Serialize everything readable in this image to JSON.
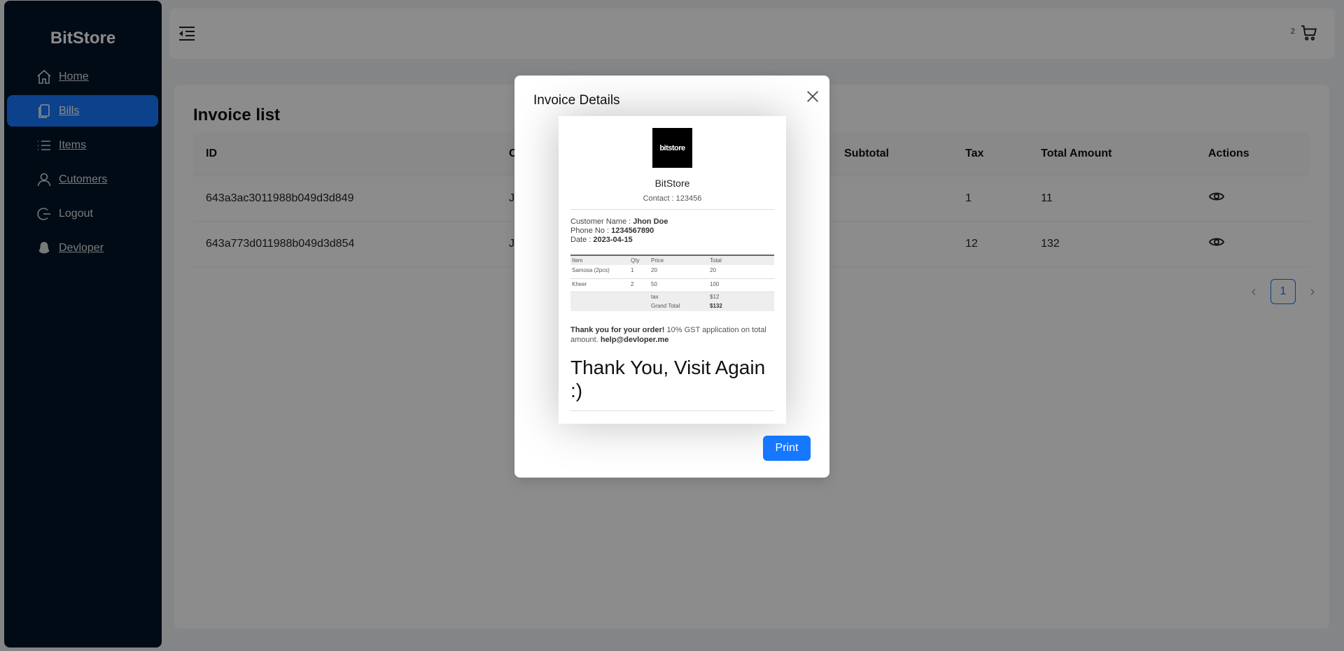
{
  "brand": "BitStore",
  "sidebar": {
    "items": [
      {
        "label": "Home",
        "icon": "home-icon"
      },
      {
        "label": "Bills",
        "icon": "bills-icon",
        "active": true
      },
      {
        "label": "Items",
        "icon": "list-icon"
      },
      {
        "label": "Cutomers",
        "icon": "user-icon"
      },
      {
        "label": "Logout",
        "icon": "logout-icon"
      },
      {
        "label": "Devloper",
        "icon": "developer-icon"
      }
    ]
  },
  "header": {
    "cart_count": "2"
  },
  "main": {
    "title": "Invoice list",
    "columns": [
      "ID",
      "C",
      "Subtotal",
      "Tax",
      "Total Amount",
      "Actions"
    ],
    "rows": [
      {
        "id": "643a3ac3011988b049d3d849",
        "customer": "J",
        "subtotal": "",
        "tax": "1",
        "total": "11"
      },
      {
        "id": "643a773d011988b049d3d854",
        "customer": "J",
        "subtotal": "",
        "tax": "12",
        "total": "132"
      }
    ],
    "page": "1"
  },
  "modal": {
    "title": "Invoice Details",
    "print_label": "Print",
    "receipt": {
      "logo_text": "bitstore",
      "store_name": "BitStore",
      "contact": "Contact : 123456",
      "customer_label": "Customer Name : ",
      "customer_name": "Jhon Doe",
      "phone_label": "Phone No : ",
      "phone": "1234567890",
      "date_label": "Date : ",
      "date": "2023-04-15",
      "columns": [
        "Item",
        "Qty",
        "Price",
        "Total"
      ],
      "items": [
        {
          "item": "Samosa (2pcs)",
          "qty": "1",
          "price": "20",
          "total": "20"
        },
        {
          "item": "Kheer",
          "qty": "2",
          "price": "50",
          "total": "100"
        }
      ],
      "tax_label": "tax",
      "tax_value": "$12",
      "grand_label": "Grand Total",
      "grand_value": "$132",
      "thanks": "Thank you for your order!",
      "gst_note": " 10% GST application on total amount. ",
      "email": "help@devloper.me",
      "farewell": "Thank You, Visit Again :)"
    }
  }
}
